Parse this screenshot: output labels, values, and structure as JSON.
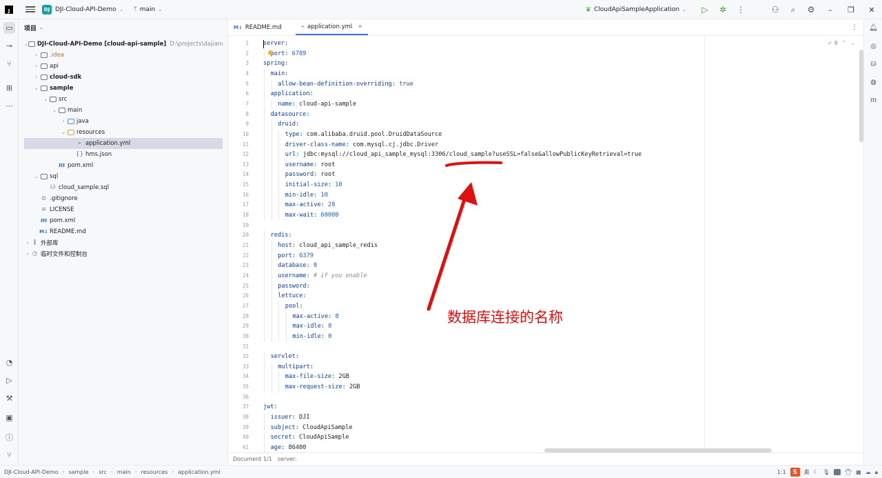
{
  "titlebar": {
    "logo_glyph": "J",
    "project_badge": "DJ",
    "project_name": "DJI-Cloud-API-Demo",
    "branch": "main",
    "run_config": "CloudApiSampleApplication"
  },
  "left_strip_icons": [
    "folder-icon",
    "commit-icon",
    "pull-request-icon",
    "structure-icon",
    "more-icon",
    "services-icon",
    "run-icon",
    "build-icon",
    "terminal-icon",
    "problems-icon",
    "git-icon"
  ],
  "project_panel": {
    "title": "项目",
    "tree": [
      {
        "label": "DJI-Cloud-API-Demo [cloud-api-sample]",
        "path": "D:\\projects\\dajiangshangyun",
        "depth": 0,
        "arrow": "v",
        "icon": "folder",
        "bold": true
      },
      {
        "label": ".idea",
        "depth": 1,
        "arrow": ">",
        "icon": "folder",
        "orange": true
      },
      {
        "label": "api",
        "depth": 1,
        "arrow": ">",
        "icon": "folder"
      },
      {
        "label": "cloud-sdk",
        "depth": 1,
        "arrow": ">",
        "icon": "folder",
        "bold": true
      },
      {
        "label": "sample",
        "depth": 1,
        "arrow": "v",
        "icon": "folder",
        "bold": true
      },
      {
        "label": "src",
        "depth": 2,
        "arrow": "v",
        "icon": "folder"
      },
      {
        "label": "main",
        "depth": 3,
        "arrow": "v",
        "icon": "folder"
      },
      {
        "label": "java",
        "depth": 4,
        "arrow": ">",
        "icon": "folder-blue"
      },
      {
        "label": "resources",
        "depth": 4,
        "arrow": "v",
        "icon": "folder-orange"
      },
      {
        "label": "application.yml",
        "depth": 5,
        "arrow": "",
        "icon": "yml",
        "selected": true
      },
      {
        "label": "hms.json",
        "depth": 5,
        "arrow": "",
        "icon": "json"
      },
      {
        "label": "pom.xml",
        "depth": 3,
        "arrow": "",
        "icon": "maven"
      },
      {
        "label": "sql",
        "depth": 1,
        "arrow": "v",
        "icon": "folder"
      },
      {
        "label": "cloud_sample.sql",
        "depth": 2,
        "arrow": "",
        "icon": "sql"
      },
      {
        "label": ".gitignore",
        "depth": 1,
        "arrow": "",
        "icon": "ignore"
      },
      {
        "label": "LICENSE",
        "depth": 1,
        "arrow": "",
        "icon": "text"
      },
      {
        "label": "pom.xml",
        "depth": 1,
        "arrow": "",
        "icon": "maven"
      },
      {
        "label": "README.md",
        "depth": 1,
        "arrow": "",
        "icon": "md"
      },
      {
        "label": "外部库",
        "depth": 0,
        "arrow": ">",
        "icon": "library"
      },
      {
        "label": "临时文件和控制台",
        "depth": 0,
        "arrow": ">",
        "icon": "scratch"
      }
    ]
  },
  "editor": {
    "tabs": [
      {
        "label": "README.md",
        "icon": "M↓",
        "active": false
      },
      {
        "label": "application.yml",
        "icon": "yml",
        "active": true
      }
    ],
    "inspection": "✓ 9",
    "lines": [
      {
        "i": 0,
        "k": "server:",
        "v": ""
      },
      {
        "i": 1,
        "k": "port:",
        "v": " 6789",
        "t": "n"
      },
      {
        "i": 0,
        "k": "spring:",
        "v": ""
      },
      {
        "i": 1,
        "k": "main:",
        "v": ""
      },
      {
        "i": 2,
        "k": "allow-bean-definition-overriding:",
        "v": " true",
        "t": "n"
      },
      {
        "i": 1,
        "k": "application:",
        "v": ""
      },
      {
        "i": 2,
        "k": "name:",
        "v": " cloud-api-sample"
      },
      {
        "i": 1,
        "k": "datasource:",
        "v": ""
      },
      {
        "i": 2,
        "k": "druid:",
        "v": ""
      },
      {
        "i": 3,
        "k": "type:",
        "v": " com.alibaba.druid.pool.DruidDataSource"
      },
      {
        "i": 3,
        "k": "driver-class-name:",
        "v": " com.mysql.cj.jdbc.Driver"
      },
      {
        "i": 3,
        "k": "url:",
        "v": " jdbc:mysql://cloud_api_sample_mysql:3306/cloud_sample?useSSL=false&allowPublicKeyRetrieval=true"
      },
      {
        "i": 3,
        "k": "username:",
        "v": " root"
      },
      {
        "i": 3,
        "k": "password:",
        "v": " root"
      },
      {
        "i": 3,
        "k": "initial-size:",
        "v": " 10",
        "t": "n"
      },
      {
        "i": 3,
        "k": "min-idle:",
        "v": " 10",
        "t": "n"
      },
      {
        "i": 3,
        "k": "max-active:",
        "v": " 20",
        "t": "n"
      },
      {
        "i": 3,
        "k": "max-wait:",
        "v": " 60000",
        "t": "n"
      },
      {
        "i": 0,
        "k": "",
        "v": ""
      },
      {
        "i": 1,
        "k": "redis:",
        "v": ""
      },
      {
        "i": 2,
        "k": "host:",
        "v": " cloud_api_sample_redis"
      },
      {
        "i": 2,
        "k": "port:",
        "v": " 6379",
        "t": "n"
      },
      {
        "i": 2,
        "k": "database:",
        "v": " 0",
        "t": "n"
      },
      {
        "i": 2,
        "k": "username:",
        "v": " # if you enable",
        "t": "c"
      },
      {
        "i": 2,
        "k": "password:",
        "v": ""
      },
      {
        "i": 2,
        "k": "lettuce:",
        "v": ""
      },
      {
        "i": 3,
        "k": "pool:",
        "v": ""
      },
      {
        "i": 4,
        "k": "max-active:",
        "v": " 8",
        "t": "n"
      },
      {
        "i": 4,
        "k": "max-idle:",
        "v": " 8",
        "t": "n"
      },
      {
        "i": 4,
        "k": "min-idle:",
        "v": " 0",
        "t": "n"
      },
      {
        "i": 0,
        "k": "",
        "v": ""
      },
      {
        "i": 1,
        "k": "servlet:",
        "v": ""
      },
      {
        "i": 2,
        "k": "multipart:",
        "v": ""
      },
      {
        "i": 3,
        "k": "max-file-size:",
        "v": " 2GB"
      },
      {
        "i": 3,
        "k": "max-request-size:",
        "v": " 2GB"
      },
      {
        "i": 0,
        "k": "",
        "v": ""
      },
      {
        "i": 0,
        "k": "jwt:",
        "v": ""
      },
      {
        "i": 1,
        "k": "issuer:",
        "v": " DJI"
      },
      {
        "i": 1,
        "k": "subject:",
        "v": " CloudApiSample"
      },
      {
        "i": 1,
        "k": "secret:",
        "v": " CloudApiSample"
      },
      {
        "i": 1,
        "k": "age:",
        "v": " 86400"
      }
    ],
    "breadcrumb": {
      "doc": "Document 1/1",
      "path": "server:"
    }
  },
  "annotation": {
    "text": "数据库连接的名称",
    "color": "#e01010"
  },
  "statusbar": {
    "crumbs": [
      "DJI-Cloud-API-Demo",
      "sample",
      "src",
      "main",
      "resources",
      "application.yml"
    ],
    "position": "1:1",
    "ime_logo": "S",
    "ime_lang": "英"
  }
}
